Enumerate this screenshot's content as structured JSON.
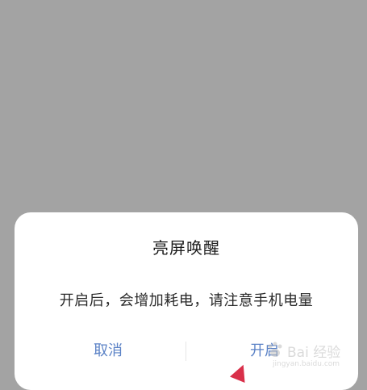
{
  "dialog": {
    "title": "亮屏唤醒",
    "message": "开启后，会增加耗电，请注意手机电量",
    "cancel_label": "取消",
    "confirm_label": "开启"
  },
  "watermark": {
    "brand": "Bai 经验",
    "url": "jingyan.baidu.com"
  },
  "colors": {
    "background": "#a3a3a3",
    "dialog": "#ffffff",
    "button_text": "#5b82c6",
    "arrow": "#d9304a"
  }
}
